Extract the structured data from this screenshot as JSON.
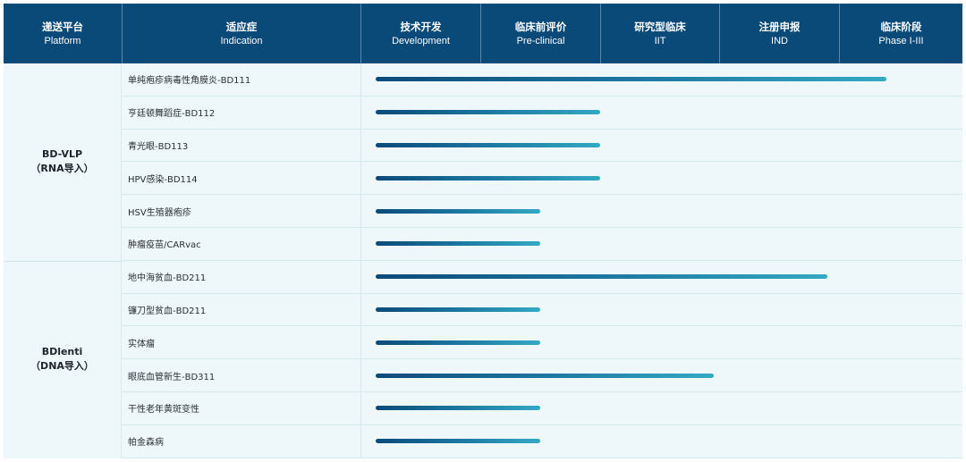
{
  "header": {
    "columns": [
      {
        "zh": "递送平台",
        "en": "Platform"
      },
      {
        "zh": "适应症",
        "en": "Indication"
      },
      {
        "zh": "技术开发",
        "en": "Development"
      },
      {
        "zh": "临床前评价",
        "en": "Pre-clinical"
      },
      {
        "zh": "研究型临床",
        "en": "IIT"
      },
      {
        "zh": "注册申报",
        "en": "IND"
      },
      {
        "zh": "临床阶段",
        "en": "Phase I-III"
      }
    ]
  },
  "platforms": [
    {
      "name_line1": "BD-VLP",
      "name_line2": "（RNA导入）"
    },
    {
      "name_line1": "BDlenti",
      "name_line2": "（DNA导入）"
    }
  ],
  "rows": [
    {
      "platform": 0,
      "indication": "单纯疱疹病毒性角膜炎-BD111",
      "progress_stage": 4.4
    },
    {
      "platform": 0,
      "indication": "亨廷顿舞蹈症-BD112",
      "progress_stage": 2.0
    },
    {
      "platform": 0,
      "indication": "青光眼-BD113",
      "progress_stage": 2.0
    },
    {
      "platform": 0,
      "indication": "HPV感染-BD114",
      "progress_stage": 2.0
    },
    {
      "platform": 0,
      "indication": "HSV生殖器疱疹",
      "progress_stage": 1.5
    },
    {
      "platform": 0,
      "indication": "肿瘤疫苗/CARvac",
      "progress_stage": 1.5
    },
    {
      "platform": 1,
      "indication": "地中海贫血-BD211",
      "progress_stage": 3.9
    },
    {
      "platform": 1,
      "indication": "镰刀型贫血-BD211",
      "progress_stage": 1.5
    },
    {
      "platform": 1,
      "indication": "实体瘤",
      "progress_stage": 1.5
    },
    {
      "platform": 1,
      "indication": "眼底血管新生-BD311",
      "progress_stage": 2.95
    },
    {
      "platform": 1,
      "indication": "干性老年黄斑变性",
      "progress_stage": 1.5
    },
    {
      "platform": 1,
      "indication": "帕金森病",
      "progress_stage": 1.5
    }
  ],
  "colors": {
    "header_bg": "#0a4a78",
    "bar_start": "#0b4a7a",
    "bar_end": "#33a9c3",
    "body_bg": "#eef7f9"
  }
}
